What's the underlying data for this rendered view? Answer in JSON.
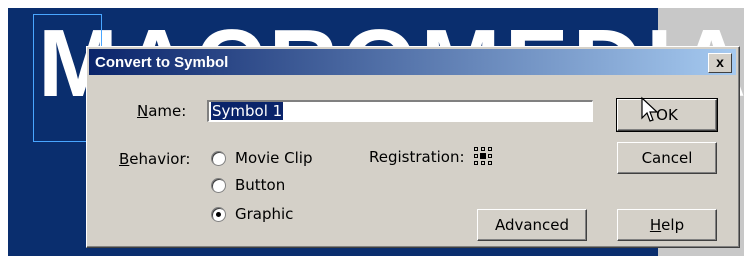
{
  "background": {
    "logo_text": "MACROMEDIA",
    "colors": {
      "backdrop": "#0a2e6e",
      "selection": "#49a6ff",
      "panel": "#c8c8c8"
    }
  },
  "dialog": {
    "title": "Convert to Symbol",
    "close_glyph": "x",
    "name": {
      "label_underlined": "N",
      "label_rest": "ame:",
      "value": "Symbol 1"
    },
    "behavior": {
      "label_underlined": "B",
      "label_rest": "ehavior:",
      "options": [
        {
          "label": "Movie Clip",
          "selected": false
        },
        {
          "label": "Button",
          "selected": false
        },
        {
          "label": "Graphic",
          "selected": true
        }
      ]
    },
    "registration": {
      "label": "Registration:",
      "selected_cell": "center"
    },
    "buttons": {
      "ok": "OK",
      "cancel": "Cancel",
      "advanced": "Advanced",
      "help_underlined": "H",
      "help_rest": "elp"
    },
    "colors": {
      "face": "#d4d0c8",
      "title_start": "#0a246a",
      "title_end": "#a6caf0"
    }
  }
}
